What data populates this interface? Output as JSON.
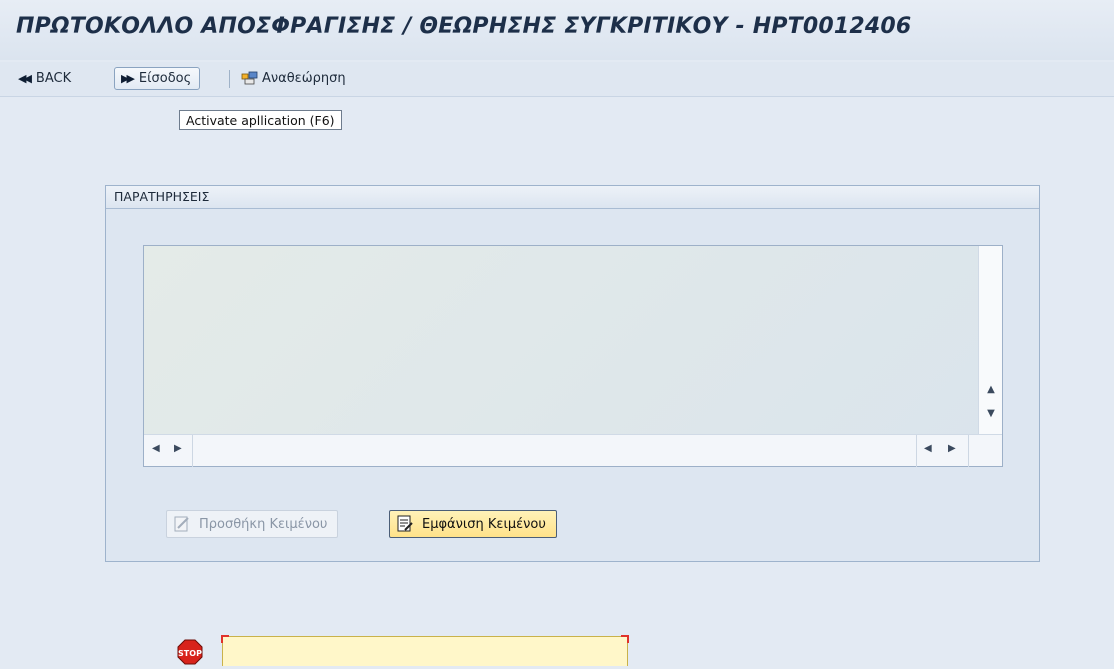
{
  "window": {
    "title": "ΠΡΩΤΟΚΟΛΛΟ ΑΠΟΣΦΡΑΓΙΣΗΣ / ΘΕΩΡΗΣΗΣ ΣΥΓΚΡΙΤΙΚΟΥ - HPT0012406"
  },
  "toolbar": {
    "back_label": "BACK",
    "enter_label": "Είσοδος",
    "refresh_label": "Αναθεώρηση",
    "tooltip": "Activate apllication  (F6)"
  },
  "remarks": {
    "title": "ΠΑΡΑΤΗΡΗΣΕΙΣ",
    "add_text_label": "Προσθήκη Κειμένου",
    "show_text_label": "Εμφάνιση Κειμένου"
  },
  "icons": {
    "back": "double-left-arrow-icon",
    "enter": "double-right-arrow-icon",
    "refresh": "refresh-icon",
    "add_text": "pencil-document-icon",
    "show_text": "document-icon",
    "status": "stop-sign-icon"
  },
  "colors": {
    "background": "#e3eaf3",
    "title_text": "#1d2f49",
    "show_button_bg": "#ffe28a",
    "input_field_bg": "#fff7c9",
    "stop_sign": "#d8231b"
  }
}
